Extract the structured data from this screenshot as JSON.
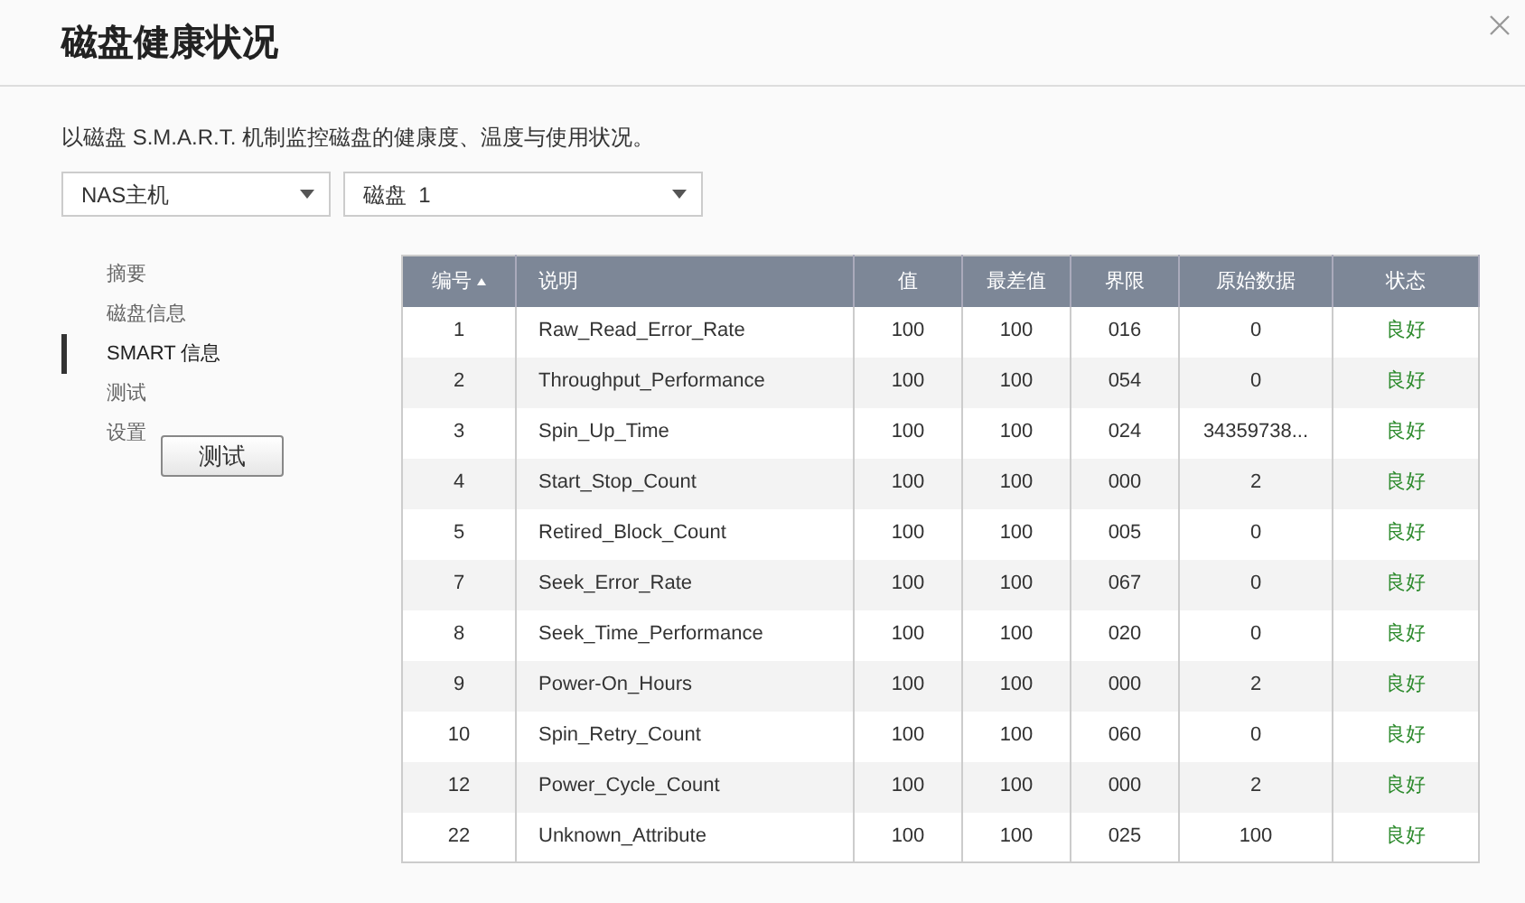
{
  "window": {
    "title": "磁盘健康状况"
  },
  "description": "以磁盘 S.M.A.R.T. 机制监控磁盘的健康度、温度与使用状况。",
  "selects": [
    {
      "value": "NAS主机"
    },
    {
      "value": "磁盘  1"
    }
  ],
  "sidebar": {
    "items": [
      {
        "label": "摘要",
        "selected": false
      },
      {
        "label": "磁盘信息",
        "selected": false
      },
      {
        "label": "SMART 信息",
        "selected": true
      },
      {
        "label": "测试",
        "selected": false
      },
      {
        "label": "设置",
        "selected": false
      }
    ]
  },
  "test_button": "测试",
  "table": {
    "columns": [
      {
        "label": "编号",
        "sorted": true
      },
      {
        "label": "说明",
        "sorted": false
      },
      {
        "label": "值",
        "sorted": false
      },
      {
        "label": "最差值",
        "sorted": false
      },
      {
        "label": "界限",
        "sorted": false
      },
      {
        "label": "原始数据",
        "sorted": false
      },
      {
        "label": "状态",
        "sorted": false
      }
    ],
    "rows": [
      [
        "1",
        "Raw_Read_Error_Rate",
        "100",
        "100",
        "016",
        "0",
        "良好"
      ],
      [
        "2",
        "Throughput_Performance",
        "100",
        "100",
        "054",
        "0",
        "良好"
      ],
      [
        "3",
        "Spin_Up_Time",
        "100",
        "100",
        "024",
        "34359738...",
        "良好"
      ],
      [
        "4",
        "Start_Stop_Count",
        "100",
        "100",
        "000",
        "2",
        "良好"
      ],
      [
        "5",
        "Retired_Block_Count",
        "100",
        "100",
        "005",
        "0",
        "良好"
      ],
      [
        "7",
        "Seek_Error_Rate",
        "100",
        "100",
        "067",
        "0",
        "良好"
      ],
      [
        "8",
        "Seek_Time_Performance",
        "100",
        "100",
        "020",
        "0",
        "良好"
      ],
      [
        "9",
        "Power-On_Hours",
        "100",
        "100",
        "000",
        "2",
        "良好"
      ],
      [
        "10",
        "Spin_Retry_Count",
        "100",
        "100",
        "060",
        "0",
        "良好"
      ],
      [
        "12",
        "Power_Cycle_Count",
        "100",
        "100",
        "000",
        "2",
        "良好"
      ],
      [
        "22",
        "Unknown_Attribute",
        "100",
        "100",
        "025",
        "100",
        "良好"
      ]
    ]
  }
}
